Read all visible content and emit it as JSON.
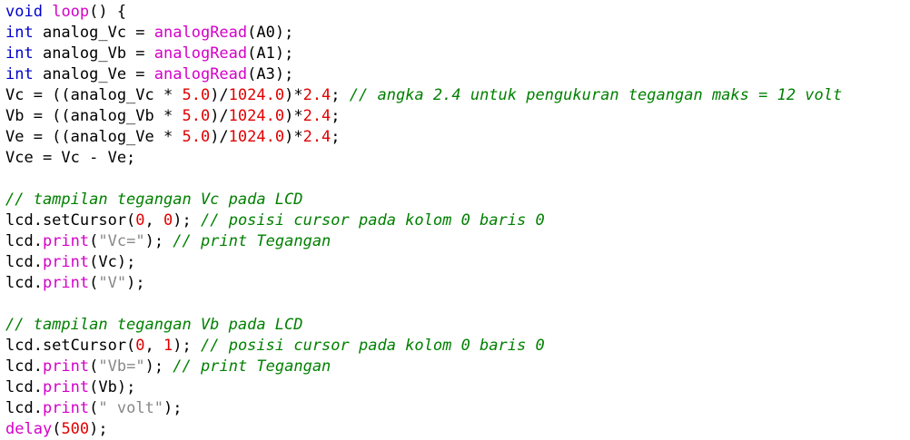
{
  "editor": {
    "language": "Arduino C++",
    "colors": {
      "plain": "#000000",
      "keyword": "#0000cc",
      "func": "#d400c8",
      "number": "#e00000",
      "comment": "#008000",
      "string": "#888888"
    },
    "lines": [
      [
        [
          "keyword",
          "void"
        ],
        [
          "plain",
          " "
        ],
        [
          "func",
          "loop"
        ],
        [
          "plain",
          "() {"
        ]
      ],
      [
        [
          "keyword",
          "int"
        ],
        [
          "plain",
          " analog_Vc = "
        ],
        [
          "func",
          "analogRead"
        ],
        [
          "plain",
          "(A0);"
        ]
      ],
      [
        [
          "keyword",
          "int"
        ],
        [
          "plain",
          " analog_Vb = "
        ],
        [
          "func",
          "analogRead"
        ],
        [
          "plain",
          "(A1);"
        ]
      ],
      [
        [
          "keyword",
          "int"
        ],
        [
          "plain",
          " analog_Ve = "
        ],
        [
          "func",
          "analogRead"
        ],
        [
          "plain",
          "(A3);"
        ]
      ],
      [
        [
          "plain",
          "Vc = ((analog_Vc * "
        ],
        [
          "number",
          "5.0"
        ],
        [
          "plain",
          ")/"
        ],
        [
          "number",
          "1024.0"
        ],
        [
          "plain",
          ")*"
        ],
        [
          "number",
          "2.4"
        ],
        [
          "plain",
          "; "
        ],
        [
          "comment",
          "// angka 2.4 untuk pengukuran tegangan maks = 12 volt"
        ]
      ],
      [
        [
          "plain",
          "Vb = ((analog_Vb * "
        ],
        [
          "number",
          "5.0"
        ],
        [
          "plain",
          ")/"
        ],
        [
          "number",
          "1024.0"
        ],
        [
          "plain",
          ")*"
        ],
        [
          "number",
          "2.4"
        ],
        [
          "plain",
          ";"
        ]
      ],
      [
        [
          "plain",
          "Ve = ((analog_Ve * "
        ],
        [
          "number",
          "5.0"
        ],
        [
          "plain",
          ")/"
        ],
        [
          "number",
          "1024.0"
        ],
        [
          "plain",
          ")*"
        ],
        [
          "number",
          "2.4"
        ],
        [
          "plain",
          ";"
        ]
      ],
      [
        [
          "plain",
          "Vce = Vc - Ve;"
        ]
      ],
      [],
      [
        [
          "comment",
          "// tampilan tegangan Vc pada LCD"
        ]
      ],
      [
        [
          "plain",
          "lcd.setCursor("
        ],
        [
          "number",
          "0"
        ],
        [
          "plain",
          ", "
        ],
        [
          "number",
          "0"
        ],
        [
          "plain",
          "); "
        ],
        [
          "comment",
          "// posisi cursor pada kolom 0 baris 0"
        ]
      ],
      [
        [
          "plain",
          "lcd."
        ],
        [
          "func",
          "print"
        ],
        [
          "plain",
          "("
        ],
        [
          "string",
          "\"Vc=\""
        ],
        [
          "plain",
          "); "
        ],
        [
          "comment",
          "// print Tegangan"
        ]
      ],
      [
        [
          "plain",
          "lcd."
        ],
        [
          "func",
          "print"
        ],
        [
          "plain",
          "(Vc);"
        ]
      ],
      [
        [
          "plain",
          "lcd."
        ],
        [
          "func",
          "print"
        ],
        [
          "plain",
          "("
        ],
        [
          "string",
          "\"V\""
        ],
        [
          "plain",
          ");"
        ]
      ],
      [],
      [
        [
          "comment",
          "// tampilan tegangan Vb pada LCD"
        ]
      ],
      [
        [
          "plain",
          "lcd.setCursor("
        ],
        [
          "number",
          "0"
        ],
        [
          "plain",
          ", "
        ],
        [
          "number",
          "1"
        ],
        [
          "plain",
          "); "
        ],
        [
          "comment",
          "// posisi cursor pada kolom 0 baris 0"
        ]
      ],
      [
        [
          "plain",
          "lcd."
        ],
        [
          "func",
          "print"
        ],
        [
          "plain",
          "("
        ],
        [
          "string",
          "\"Vb=\""
        ],
        [
          "plain",
          "); "
        ],
        [
          "comment",
          "// print Tegangan"
        ]
      ],
      [
        [
          "plain",
          "lcd."
        ],
        [
          "func",
          "print"
        ],
        [
          "plain",
          "(Vb);"
        ]
      ],
      [
        [
          "plain",
          "lcd."
        ],
        [
          "func",
          "print"
        ],
        [
          "plain",
          "("
        ],
        [
          "string",
          "\" volt\""
        ],
        [
          "plain",
          ");"
        ]
      ],
      [
        [
          "func",
          "delay"
        ],
        [
          "plain",
          "("
        ],
        [
          "number",
          "500"
        ],
        [
          "plain",
          ");"
        ]
      ]
    ]
  }
}
